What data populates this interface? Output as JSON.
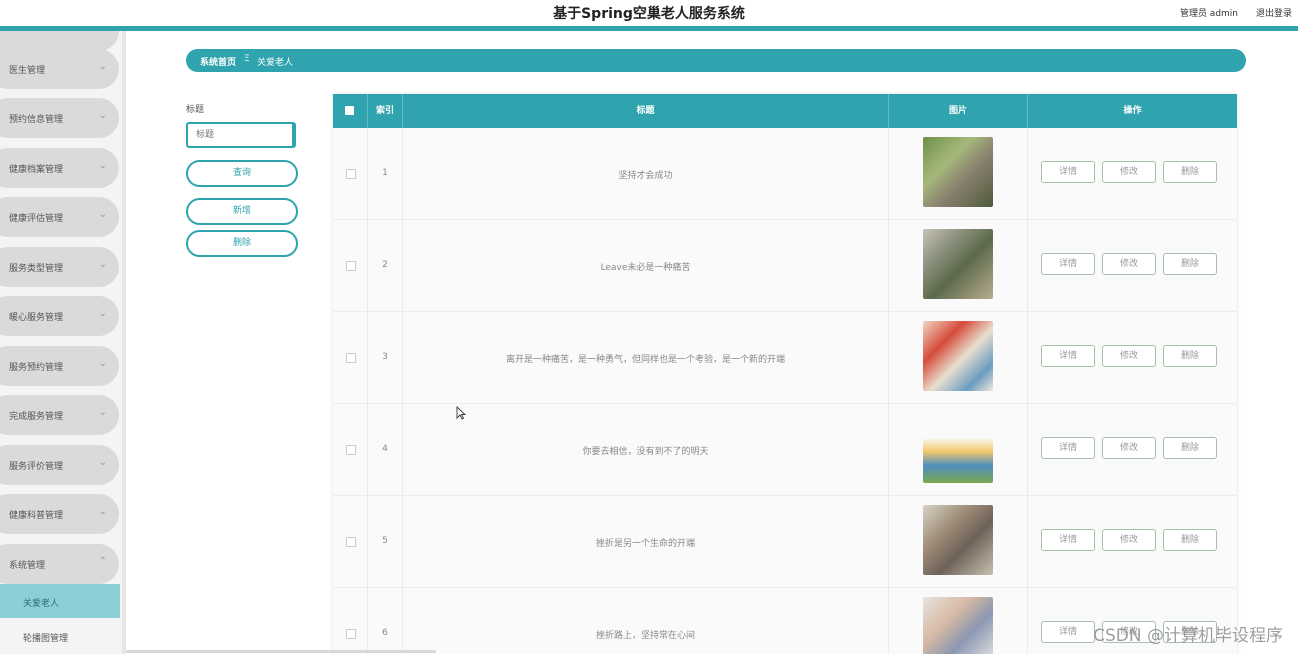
{
  "header": {
    "app_title": "基于Spring空巢老人服务系统",
    "user_label": "管理员 admin",
    "logout_label": "退出登录",
    "accent_color": "#2fa3ae"
  },
  "sidebar": {
    "items": [
      {
        "label": "医生管理"
      },
      {
        "label": "预约信息管理"
      },
      {
        "label": "健康档案管理"
      },
      {
        "label": "健康评估管理"
      },
      {
        "label": "服务类型管理"
      },
      {
        "label": "暖心服务管理"
      },
      {
        "label": "服务预约管理"
      },
      {
        "label": "完成服务管理"
      },
      {
        "label": "服务评价管理"
      },
      {
        "label": "健康科普管理"
      },
      {
        "label": "系统管理"
      }
    ],
    "sub_items": [
      {
        "label": "关爱老人",
        "active": true
      },
      {
        "label": "轮播图管理",
        "active": false
      }
    ]
  },
  "breadcrumb": {
    "home": "系统首页",
    "separator": "Ξ",
    "current": "关爱老人"
  },
  "filter": {
    "label": "标题",
    "placeholder": "标题",
    "query_button": "查询",
    "add_button": "新增",
    "delete_button": "删除"
  },
  "table": {
    "headers": {
      "index": "索引",
      "title": "标题",
      "image": "图片",
      "actions": "操作"
    },
    "action_labels": {
      "detail": "详情",
      "edit": "修改",
      "delete": "删除"
    },
    "rows": [
      {
        "index": "1",
        "title": "坚持才会成功"
      },
      {
        "index": "2",
        "title": "Leave未必是一种痛苦"
      },
      {
        "index": "3",
        "title": "离开是一种痛苦，是一种勇气，但同样也是一个考验，是一个新的开端"
      },
      {
        "index": "4",
        "title": "你要去相信，没有到不了的明天"
      },
      {
        "index": "5",
        "title": "挫折是另一个生命的开端"
      },
      {
        "index": "6",
        "title": "挫折路上，坚持常在心间"
      }
    ]
  },
  "watermark": "CSDN @计算机毕设程序"
}
